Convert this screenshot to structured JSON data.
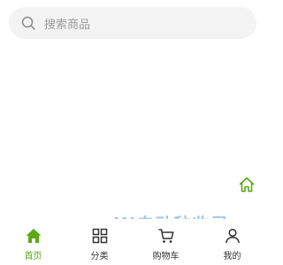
{
  "search": {
    "placeholder": "搜索商品",
    "icon": "search-icon"
  },
  "floating": {
    "icon": "home-outline-icon"
  },
  "tabbar": {
    "accent": "#5aa815",
    "tabs": [
      {
        "label": "首页",
        "icon": "home-icon",
        "active": true
      },
      {
        "label": "分类",
        "icon": "grid-icon",
        "active": false
      },
      {
        "label": "购物车",
        "icon": "cart-icon",
        "active": false
      },
      {
        "label": "我的",
        "icon": "user-icon",
        "active": false
      }
    ]
  },
  "watermark": {
    "title": "JN自动秒收录",
    "subtitle": "放上链接一访一次一自动收录"
  }
}
